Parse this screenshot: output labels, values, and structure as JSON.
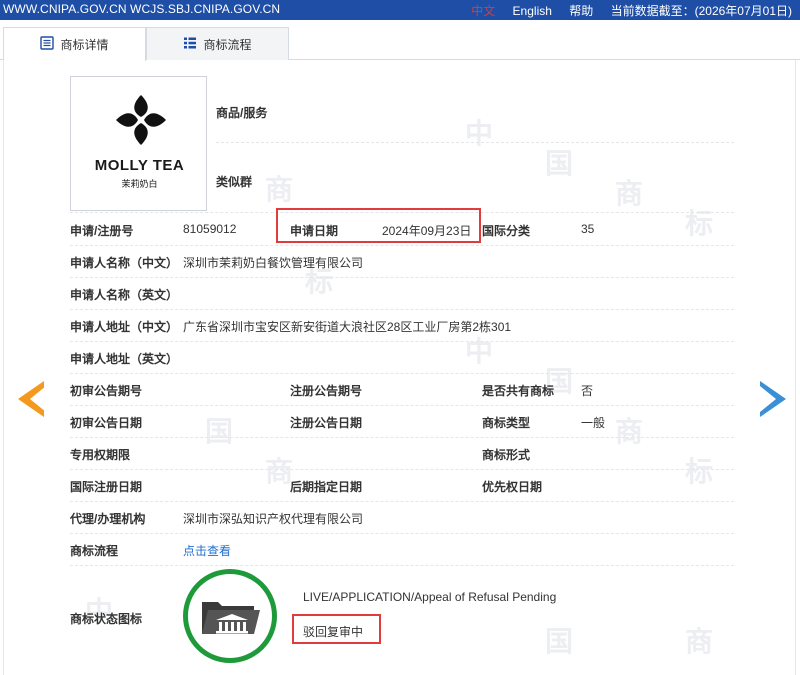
{
  "topbar": {
    "site_links": "WWW.CNIPA.GOV.CN WCJS.SBJ.CNIPA.GOV.CN",
    "lang_zh": "中文",
    "lang_en": "English",
    "help": "帮助",
    "data_date": "当前数据截至：(2026年07月01日)"
  },
  "tabs": [
    {
      "label": "商标详情"
    },
    {
      "label": "商标流程"
    }
  ],
  "logo": {
    "name": "MOLLY TEA",
    "subtitle": "茉莉奶白"
  },
  "fields": {
    "goods_services": {
      "label": "商品/服务"
    },
    "similar_group": {
      "label": "类似群"
    },
    "reg_no": {
      "label": "申请/注册号",
      "value": "81059012"
    },
    "apply_date": {
      "label": "申请日期",
      "value": "2024年09月23日"
    },
    "intl_class": {
      "label": "国际分类",
      "value": "35"
    },
    "applicant_cn": {
      "label": "申请人名称（中文）",
      "value": "深圳市茉莉奶白餐饮管理有限公司"
    },
    "applicant_en": {
      "label": "申请人名称（英文）"
    },
    "address_cn": {
      "label": "申请人地址（中文）",
      "value": "广东省深圳市宝安区新安街道大浪社区28区工业厂房第2栋301"
    },
    "address_en": {
      "label": "申请人地址（英文）"
    },
    "prelim_no": {
      "label": "初审公告期号"
    },
    "reg_notice_no": {
      "label": "注册公告期号"
    },
    "shared": {
      "label": "是否共有商标",
      "value": "否"
    },
    "prelim_date": {
      "label": "初审公告日期"
    },
    "reg_notice_date": {
      "label": "注册公告日期"
    },
    "tm_type": {
      "label": "商标类型",
      "value": "一般"
    },
    "exclusive_period": {
      "label": "专用权期限"
    },
    "tm_form": {
      "label": "商标形式"
    },
    "intl_reg_date": {
      "label": "国际注册日期"
    },
    "later_date": {
      "label": "后期指定日期"
    },
    "priority_date": {
      "label": "优先权日期"
    },
    "agency": {
      "label": "代理/办理机构",
      "value": "深圳市深弘知识产权代理有限公司"
    },
    "process": {
      "label": "商标流程",
      "value": "点击查看"
    },
    "status_icon": {
      "label": "商标状态图标"
    }
  },
  "status": {
    "english": "LIVE/APPLICATION/Appeal of Refusal Pending",
    "chinese": "驳回复审中"
  },
  "colors": {
    "topbar": "#1e4ea5",
    "highlight": "#e13b3b",
    "status_ring": "#1f9a3b",
    "prev_arrow": "#f39a1e",
    "next_arrow": "#3b8fd6",
    "link": "#1f6fd1"
  }
}
